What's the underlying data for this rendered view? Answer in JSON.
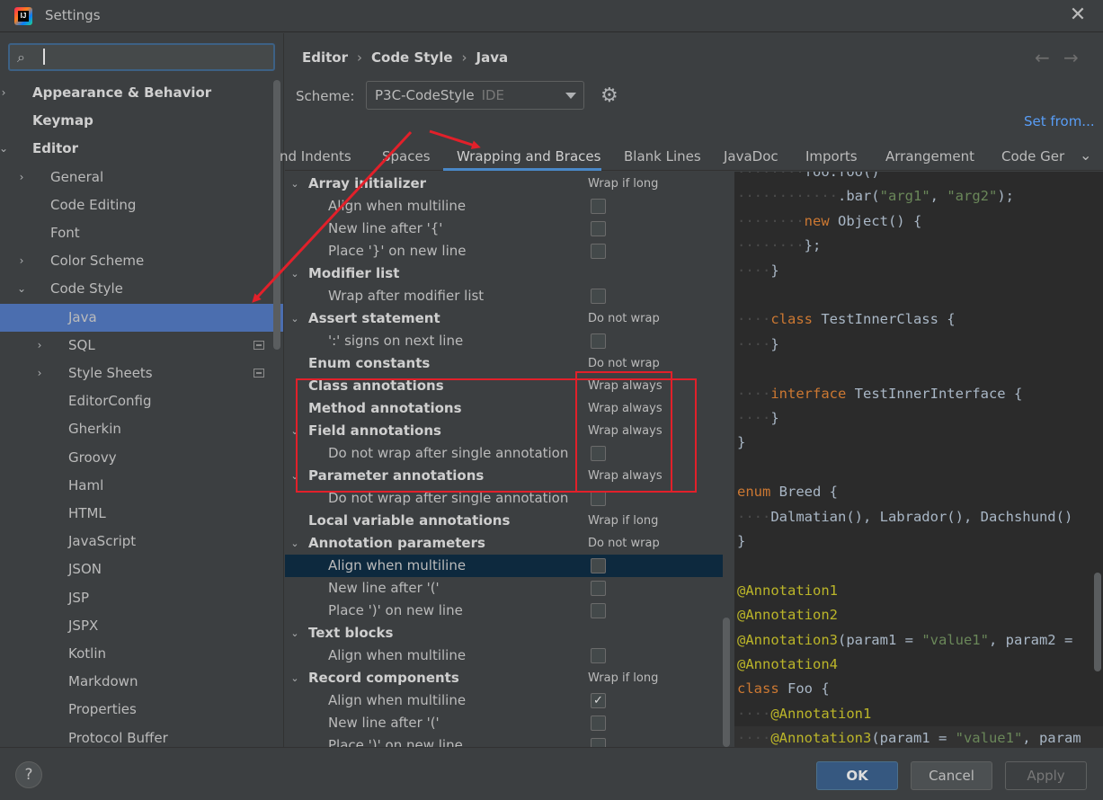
{
  "window": {
    "title": "Settings",
    "close_icon": "close-icon"
  },
  "sidebar": {
    "search_placeholder": "",
    "items": [
      {
        "label": "Appearance & Behavior",
        "chevron": "›",
        "bold": true
      },
      {
        "label": "Keymap",
        "chevron": "",
        "bold": true
      },
      {
        "label": "Editor",
        "chevron": "⌄",
        "bold": true
      },
      {
        "label": "General",
        "chevron": "›"
      },
      {
        "label": "Code Editing",
        "chevron": ""
      },
      {
        "label": "Font",
        "chevron": ""
      },
      {
        "label": "Color Scheme",
        "chevron": "›"
      },
      {
        "label": "Code Style",
        "chevron": "⌄"
      },
      {
        "label": "Java",
        "chevron": "",
        "selected": true
      },
      {
        "label": "SQL",
        "chevron": "›",
        "project_icon": true
      },
      {
        "label": "Style Sheets",
        "chevron": "›",
        "project_icon": true
      },
      {
        "label": "EditorConfig",
        "chevron": ""
      },
      {
        "label": "Gherkin",
        "chevron": ""
      },
      {
        "label": "Groovy",
        "chevron": ""
      },
      {
        "label": "Haml",
        "chevron": ""
      },
      {
        "label": "HTML",
        "chevron": ""
      },
      {
        "label": "JavaScript",
        "chevron": ""
      },
      {
        "label": "JSON",
        "chevron": ""
      },
      {
        "label": "JSP",
        "chevron": ""
      },
      {
        "label": "JSPX",
        "chevron": ""
      },
      {
        "label": "Kotlin",
        "chevron": ""
      },
      {
        "label": "Markdown",
        "chevron": ""
      },
      {
        "label": "Properties",
        "chevron": ""
      },
      {
        "label": "Protocol Buffer",
        "chevron": ""
      }
    ]
  },
  "breadcrumb": [
    "Editor",
    "Code Style",
    "Java"
  ],
  "scheme": {
    "label": "Scheme:",
    "value": "P3C-CodeStyle",
    "scope": "IDE"
  },
  "set_from": "Set from...",
  "tabs": [
    {
      "label": "nd Indents"
    },
    {
      "label": "Spaces"
    },
    {
      "label": "Wrapping and Braces",
      "active": true
    },
    {
      "label": "Blank Lines"
    },
    {
      "label": "JavaDoc"
    },
    {
      "label": "Imports"
    },
    {
      "label": "Arrangement"
    },
    {
      "label": "Code Ger"
    }
  ],
  "options": [
    {
      "label": "Array initializer",
      "type": "group",
      "chevron": true,
      "value": "Wrap if long"
    },
    {
      "label": "Align when multiline",
      "type": "check",
      "checked": false
    },
    {
      "label": "New line after '{'",
      "type": "check",
      "checked": false
    },
    {
      "label": "Place '}' on new line",
      "type": "check",
      "checked": false
    },
    {
      "label": "Modifier list",
      "type": "group",
      "chevron": true,
      "value": ""
    },
    {
      "label": "Wrap after modifier list",
      "type": "check",
      "checked": false
    },
    {
      "label": "Assert statement",
      "type": "group",
      "chevron": true,
      "value": "Do not wrap"
    },
    {
      "label": "':' signs on next line",
      "type": "check",
      "checked": false
    },
    {
      "label": "Enum constants",
      "type": "group",
      "chevron": false,
      "value": "Do not wrap"
    },
    {
      "label": "Class annotations",
      "type": "group",
      "chevron": false,
      "value": "Wrap always"
    },
    {
      "label": "Method annotations",
      "type": "group",
      "chevron": false,
      "value": "Wrap always"
    },
    {
      "label": "Field annotations",
      "type": "group",
      "chevron": true,
      "value": "Wrap always"
    },
    {
      "label": "Do not wrap after single annotation",
      "type": "check",
      "checked": false
    },
    {
      "label": "Parameter annotations",
      "type": "group",
      "chevron": true,
      "value": "Wrap always"
    },
    {
      "label": "Do not wrap after single annotation",
      "type": "check",
      "checked": false
    },
    {
      "label": "Local variable annotations",
      "type": "group",
      "chevron": false,
      "value": "Wrap if long"
    },
    {
      "label": "Annotation parameters",
      "type": "group",
      "chevron": true,
      "value": "Do not wrap"
    },
    {
      "label": "Align when multiline",
      "type": "check",
      "checked": false,
      "highlight": true
    },
    {
      "label": "New line after '('",
      "type": "check",
      "checked": false
    },
    {
      "label": "Place ')' on new line",
      "type": "check",
      "checked": false
    },
    {
      "label": "Text blocks",
      "type": "group",
      "chevron": true,
      "value": ""
    },
    {
      "label": "Align when multiline",
      "type": "check",
      "checked": false
    },
    {
      "label": "Record components",
      "type": "group",
      "chevron": true,
      "value": "Wrap if long"
    },
    {
      "label": "Align when multiline",
      "type": "check",
      "checked": true
    },
    {
      "label": "New line after '('",
      "type": "check",
      "checked": false
    },
    {
      "label": "Place ')' on new line",
      "type": "check",
      "checked": false
    }
  ],
  "preview": {
    "lines": [
      [
        {
          "t": "········",
          "c": "ws"
        },
        {
          "t": "foo.foo()"
        }
      ],
      [
        {
          "t": "············",
          "c": "ws"
        },
        {
          "t": ".bar("
        },
        {
          "t": "\"arg1\"",
          "c": "s"
        },
        {
          "t": ", "
        },
        {
          "t": "\"arg2\"",
          "c": "s"
        },
        {
          "t": ");"
        }
      ],
      [
        {
          "t": "········",
          "c": "ws"
        },
        {
          "t": "new ",
          "c": "k"
        },
        {
          "t": "Object() {"
        }
      ],
      [
        {
          "t": "········",
          "c": "ws"
        },
        {
          "t": "};"
        }
      ],
      [
        {
          "t": "····",
          "c": "ws"
        },
        {
          "t": "}"
        }
      ],
      [],
      [
        {
          "t": "····",
          "c": "ws"
        },
        {
          "t": "class ",
          "c": "k"
        },
        {
          "t": "TestInnerClass {"
        }
      ],
      [
        {
          "t": "····",
          "c": "ws"
        },
        {
          "t": "}"
        }
      ],
      [],
      [
        {
          "t": "····",
          "c": "ws"
        },
        {
          "t": "interface ",
          "c": "k"
        },
        {
          "t": "TestInnerInterface {"
        }
      ],
      [
        {
          "t": "····",
          "c": "ws"
        },
        {
          "t": "}"
        }
      ],
      [
        {
          "t": "}"
        }
      ],
      [],
      [
        {
          "t": "enum ",
          "c": "k"
        },
        {
          "t": "Breed {"
        }
      ],
      [
        {
          "t": "····",
          "c": "ws"
        },
        {
          "t": "Dalmatian(), Labrador(), Dachshund()"
        }
      ],
      [
        {
          "t": "}"
        }
      ],
      [],
      [
        {
          "t": "@Annotation1",
          "c": "an"
        }
      ],
      [
        {
          "t": "@Annotation2",
          "c": "an"
        }
      ],
      [
        {
          "t": "@Annotation3",
          "c": "an"
        },
        {
          "t": "(param1 = "
        },
        {
          "t": "\"value1\"",
          "c": "s"
        },
        {
          "t": ", param2 ="
        }
      ],
      [
        {
          "t": "@Annotation4",
          "c": "an"
        }
      ],
      [
        {
          "t": "class ",
          "c": "k"
        },
        {
          "t": "Foo {"
        }
      ],
      [
        {
          "t": "····",
          "c": "ws"
        },
        {
          "t": "@Annotation1",
          "c": "an"
        }
      ],
      [
        {
          "t": "····",
          "c": "ws"
        },
        {
          "t": "@Annotation3",
          "c": "an"
        },
        {
          "t": "(param1 = "
        },
        {
          "t": "\"value1\"",
          "c": "s"
        },
        {
          "t": ", param"
        }
      ]
    ],
    "current_line": 23
  },
  "footer": {
    "help": "?",
    "ok": "OK",
    "cancel": "Cancel",
    "apply": "Apply"
  },
  "colors": {
    "accent": "#4b6eaf",
    "annotation_red": "#e2202a",
    "link": "#589df6"
  }
}
